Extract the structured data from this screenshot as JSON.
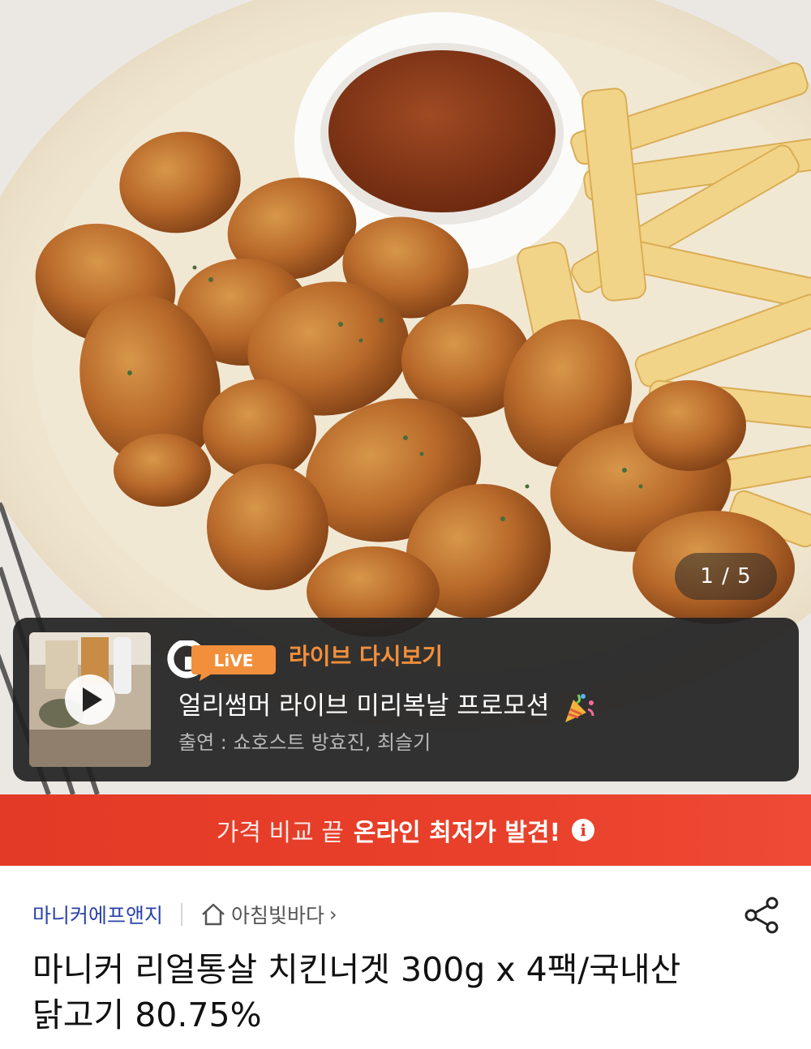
{
  "gallery": {
    "counter": "1 / 5"
  },
  "live": {
    "badge_logo": "G LiVE",
    "badge_text": "LiVE",
    "label": "라이브 다시보기",
    "title": "얼리썸머 라이브 미리복날 프로모션",
    "cast": "출연 : 쇼호스트 방효진, 최슬기",
    "icon": "play-icon",
    "accent": "#f28f3b"
  },
  "banner": {
    "text_normal": "가격 비교 끝",
    "text_bold": "온라인 최저가 발견!",
    "info_symbol": "i",
    "color": "#e23a26"
  },
  "product": {
    "brand": "마니커에프앤지",
    "store": "아침빛바다",
    "store_chevron": "›",
    "title": "마니커 리얼통살 치킨너겟 300g x 4팩/국내산 닭고기 80.75%",
    "brand_color": "#2a43a8"
  }
}
